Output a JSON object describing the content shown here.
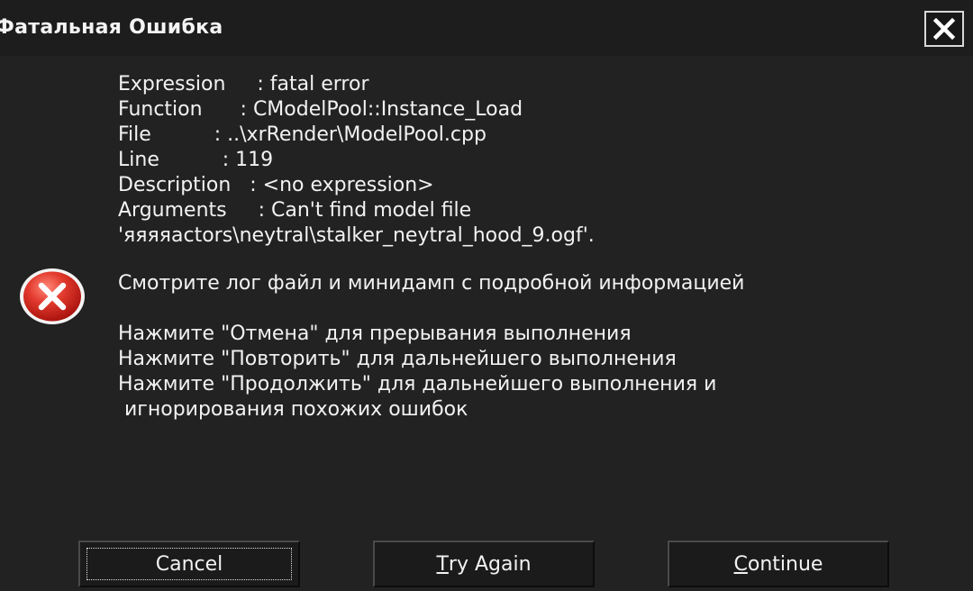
{
  "window": {
    "title": "Фатальная Ошибка",
    "close_symbol": "✕"
  },
  "message": {
    "details": [
      "Expression     : fatal error",
      "Function      : CModelPool::Instance_Load",
      "File          : ..\\xrRender\\ModelPool.cpp",
      "Line          : 119",
      "Description   : <no expression>",
      "Arguments     : Can't find model file",
      "'яяяяactors\\neytral\\stalker_neytral_hood_9.ogf'."
    ],
    "log_hint": "Смотрите лог файл и минидамп с подробной информацией",
    "instructions": [
      "Нажмите \"Отмена\" для прерывания выполнения",
      "Нажмите \"Повторить\" для дальнейшего выполнения",
      "Нажмите \"Продолжить\" для дальнейшего выполнения и",
      " игнорирования похожих ошибок"
    ]
  },
  "icon": {
    "name": "error-icon",
    "color": "#d32a2a"
  },
  "buttons": {
    "cancel": {
      "label": "Cancel"
    },
    "try_again": {
      "accel": "T",
      "rest": "ry Again"
    },
    "continue": {
      "accel": "C",
      "rest": "ontinue"
    }
  },
  "colors": {
    "background": "#222222",
    "text": "#f2f2f2",
    "error_red": "#d32a2a"
  }
}
